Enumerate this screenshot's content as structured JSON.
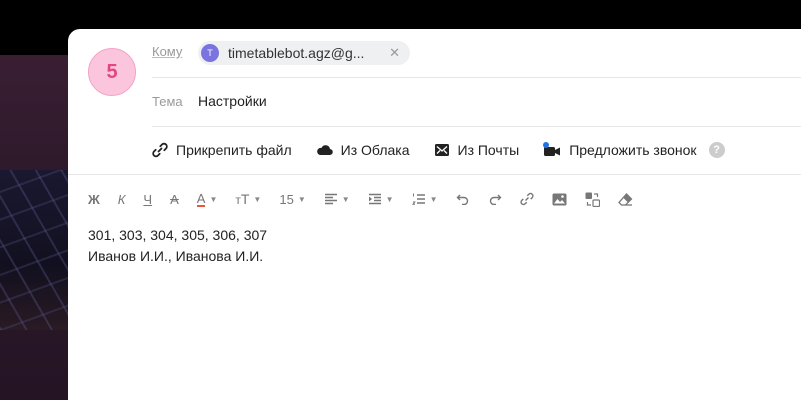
{
  "compose": {
    "avatar_initial": "5",
    "to_label": "Кому",
    "recipient": {
      "initial": "T",
      "email": "timetablebot.agz@g..."
    },
    "subject_label": "Тема",
    "subject_value": "Настройки",
    "attach": {
      "attach_file": "Прикрепить файл",
      "from_cloud": "Из Облака",
      "from_mail": "Из Почты",
      "suggest_call": "Предложить звонок"
    },
    "toolbar": {
      "bold": "Ж",
      "italic": "К",
      "underline": "Ч",
      "strike": "А",
      "text_color": "А",
      "font_size": "15"
    },
    "body_lines": [
      "301, 303, 304, 305, 306, 307",
      "Иванов И.И., Иванова И.И."
    ]
  },
  "colors": {
    "avatar_bg": "#fbc6dd",
    "avatar_text": "#e0487f",
    "chip_avatar": "#7b73e0",
    "text_color_underline": "#e8563b",
    "call_dot": "#1a73e8"
  }
}
